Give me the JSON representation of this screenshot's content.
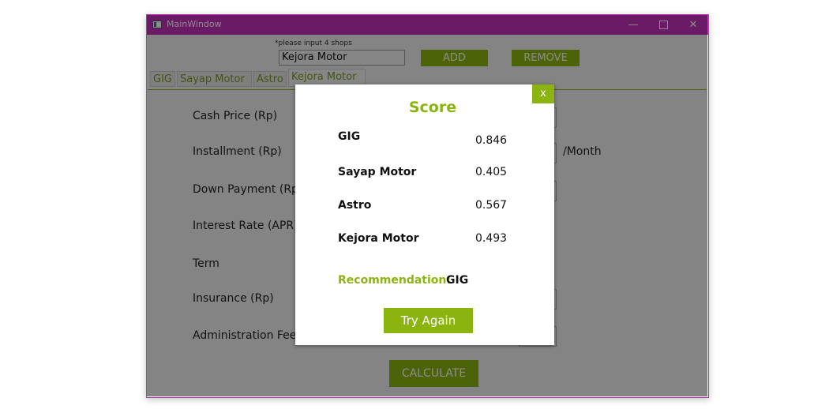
{
  "window": {
    "title": "MainWindow",
    "minimize_icon": "minimize-icon",
    "maximize_icon": "maximize-icon",
    "close_label": "✕"
  },
  "shops": {
    "hint": "*please input 4 shops",
    "input_value": "Kejora Motor",
    "add_label": "ADD",
    "remove_label": "REMOVE"
  },
  "tabs": [
    {
      "label": "GIG"
    },
    {
      "label": "Sayap Motor"
    },
    {
      "label": "Astro"
    },
    {
      "label": "Kejora Motor"
    }
  ],
  "form": {
    "cash_price_label": "Cash Price (Rp)",
    "installment_label": "Installment (Rp)",
    "installment_suffix": "/Month",
    "down_payment_label": "Down Payment (Rp)",
    "interest_rate_label": "Interest Rate (APR)",
    "term_label": "Term",
    "insurance_label": "Insurance (Rp)",
    "admin_fee_label": "Administration Fee",
    "calculate_label": "CALCULATE"
  },
  "dialog": {
    "close_label": "x",
    "title": "Score",
    "scores": [
      {
        "name": "GIG",
        "value": "0.846"
      },
      {
        "name": "Sayap Motor",
        "value": "0.405"
      },
      {
        "name": "Astro",
        "value": "0.567"
      },
      {
        "name": "Kejora Motor",
        "value": "0.493"
      }
    ],
    "recommendation_label": "Recommendation:",
    "recommendation_value": "GIG",
    "try_again_label": "Try Again"
  },
  "colors": {
    "accent": "#8cb410",
    "titlebar": "#c431b8"
  }
}
